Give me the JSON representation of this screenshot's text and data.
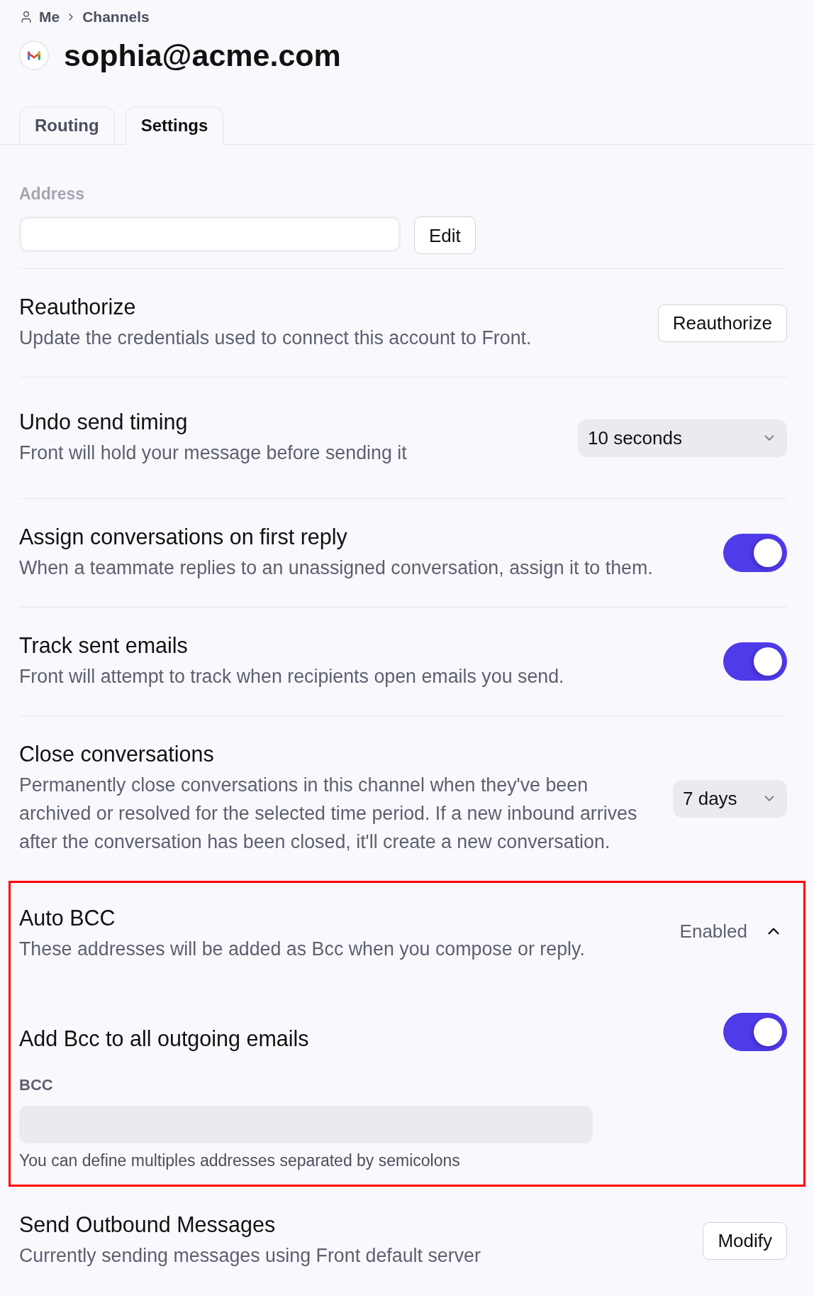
{
  "breadcrumb": [
    "Me",
    "Channels"
  ],
  "title": "sophia@acme.com",
  "tabs": [
    {
      "label": "Routing",
      "selected": false
    },
    {
      "label": "Settings",
      "selected": true
    }
  ],
  "address": {
    "label": "Address",
    "button": "Edit"
  },
  "settings": [
    {
      "kind": "button",
      "title": "Reauthorize",
      "description": "Update the credentials used to connect this account to Front.",
      "button": "Reauthorize"
    },
    {
      "kind": "select",
      "title": "Undo send timing",
      "description": "Front will hold your message before sending it",
      "value": "10 seconds"
    },
    {
      "kind": "toggle",
      "title": "Assign conversations on first reply",
      "description": "When a teammate replies to an unassigned conversation, assign it to them.",
      "on": true
    },
    {
      "kind": "toggle",
      "title": "Track sent emails",
      "description": "Front will attempt to track when recipients open emails you send.",
      "on": true
    },
    {
      "kind": "select",
      "title": "Close conversations",
      "description": "Permanently close conversations in this channel when they've been archived or resolved for the selected time period. If a new inbound arrives after the conversation has been closed, it'll create a new conversation.",
      "value": "7 days"
    },
    {
      "kind": "expandable",
      "title": "Auto BCC",
      "description": "These addresses will be added as Bcc when you compose or reply.",
      "status": "Enabled",
      "expanded": true,
      "highlighted": true,
      "option": {
        "title": "Add Bcc to all outgoing emails",
        "on": true
      },
      "field": {
        "label": "BCC",
        "hint": "You can define multiples addresses separated by semicolons"
      }
    },
    {
      "kind": "button",
      "title": "Send Outbound Messages",
      "description": "Currently sending messages using Front default server",
      "button": "Modify"
    }
  ]
}
